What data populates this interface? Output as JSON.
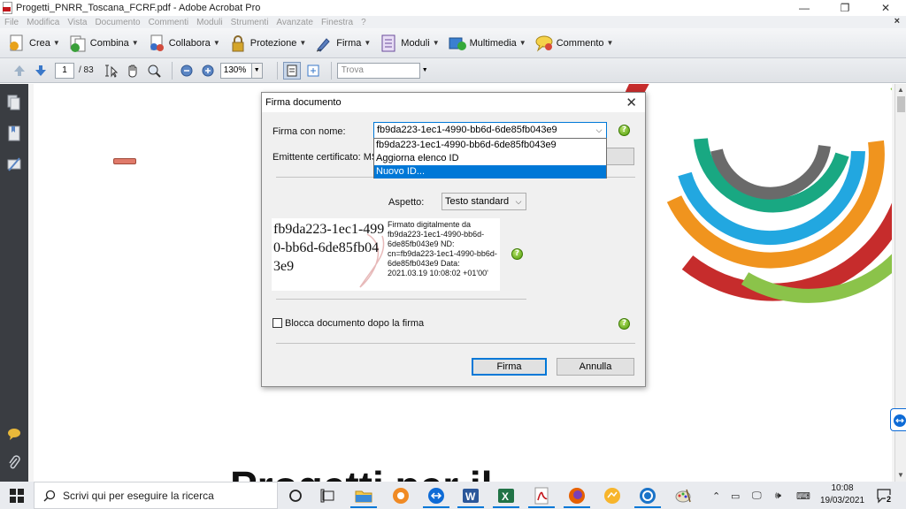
{
  "window": {
    "title": "Progetti_PNRR_Toscana_FCRF.pdf - Adobe Acrobat Pro",
    "minimize": "—",
    "restore": "❐",
    "close": "✕"
  },
  "menubar": {
    "items": [
      "File",
      "Modifica",
      "Vista",
      "Documento",
      "Commenti",
      "Moduli",
      "Strumenti",
      "Avanzate",
      "Finestra",
      "?"
    ],
    "close_doc": "×"
  },
  "tasks": {
    "items": [
      {
        "label": "Crea",
        "icon": "create-icon"
      },
      {
        "label": "Combina",
        "icon": "combine-icon"
      },
      {
        "label": "Collabora",
        "icon": "collaborate-icon"
      },
      {
        "label": "Protezione",
        "icon": "lock-icon"
      },
      {
        "label": "Firma",
        "icon": "sign-pen-icon"
      },
      {
        "label": "Moduli",
        "icon": "forms-icon"
      },
      {
        "label": "Multimedia",
        "icon": "multimedia-icon"
      },
      {
        "label": "Commento",
        "icon": "comment-icon"
      }
    ]
  },
  "navbar": {
    "page_current": "1",
    "page_total": "/ 83",
    "zoom": "130%",
    "find_placeholder": "Trova"
  },
  "document": {
    "heading_partial": "Progetti per il"
  },
  "dialog": {
    "title": "Firma documento",
    "sign_as_label": "Firma con nome:",
    "sign_as_value": "fb9da223-1ec1-4990-bb6d-6de85fb043e9",
    "dropdown_options": [
      "fb9da223-1ec1-4990-bb6d-6de85fb043e9",
      "Aggiorna elenco ID",
      "Nuovo ID..."
    ],
    "dropdown_selected_index": 2,
    "issuer_label": "Emittente certificato: MS-O",
    "appearance_label": "Aspetto:",
    "appearance_value": "Testo standard",
    "preview_name": "fb9da223-1ec1-4990-bb6d-6de85fb043e9",
    "preview_details": "Firmato digitalmente da fb9da223-1ec1-4990-bb6d-6de85fb043e9 ND: cn=fb9da223-1ec1-4990-bb6d-6de85fb043e9 Data: 2021.03.19 10:08:02 +01'00'",
    "lock_label": "Blocca documento dopo la firma",
    "lock_checked": false,
    "sign_button": "Firma",
    "cancel_button": "Annulla",
    "help_glyph": "?"
  },
  "taskbar": {
    "search_placeholder": "Scrivi qui per eseguire la ricerca",
    "time": "10:08",
    "date": "19/03/2021",
    "notifications": "2",
    "apps": [
      "cortana-icon",
      "task-view-icon",
      "file-explorer-icon",
      "app-orange-icon",
      "teamviewer-icon",
      "word-icon",
      "excel-icon",
      "acrobat-icon",
      "firefox-icon",
      "app-yellow-icon",
      "app-blue-icon",
      "paint-icon"
    ]
  },
  "colors": {
    "accent": "#0078d7",
    "left_panel": "#3a3d42",
    "help_green": "#4e9a06"
  }
}
